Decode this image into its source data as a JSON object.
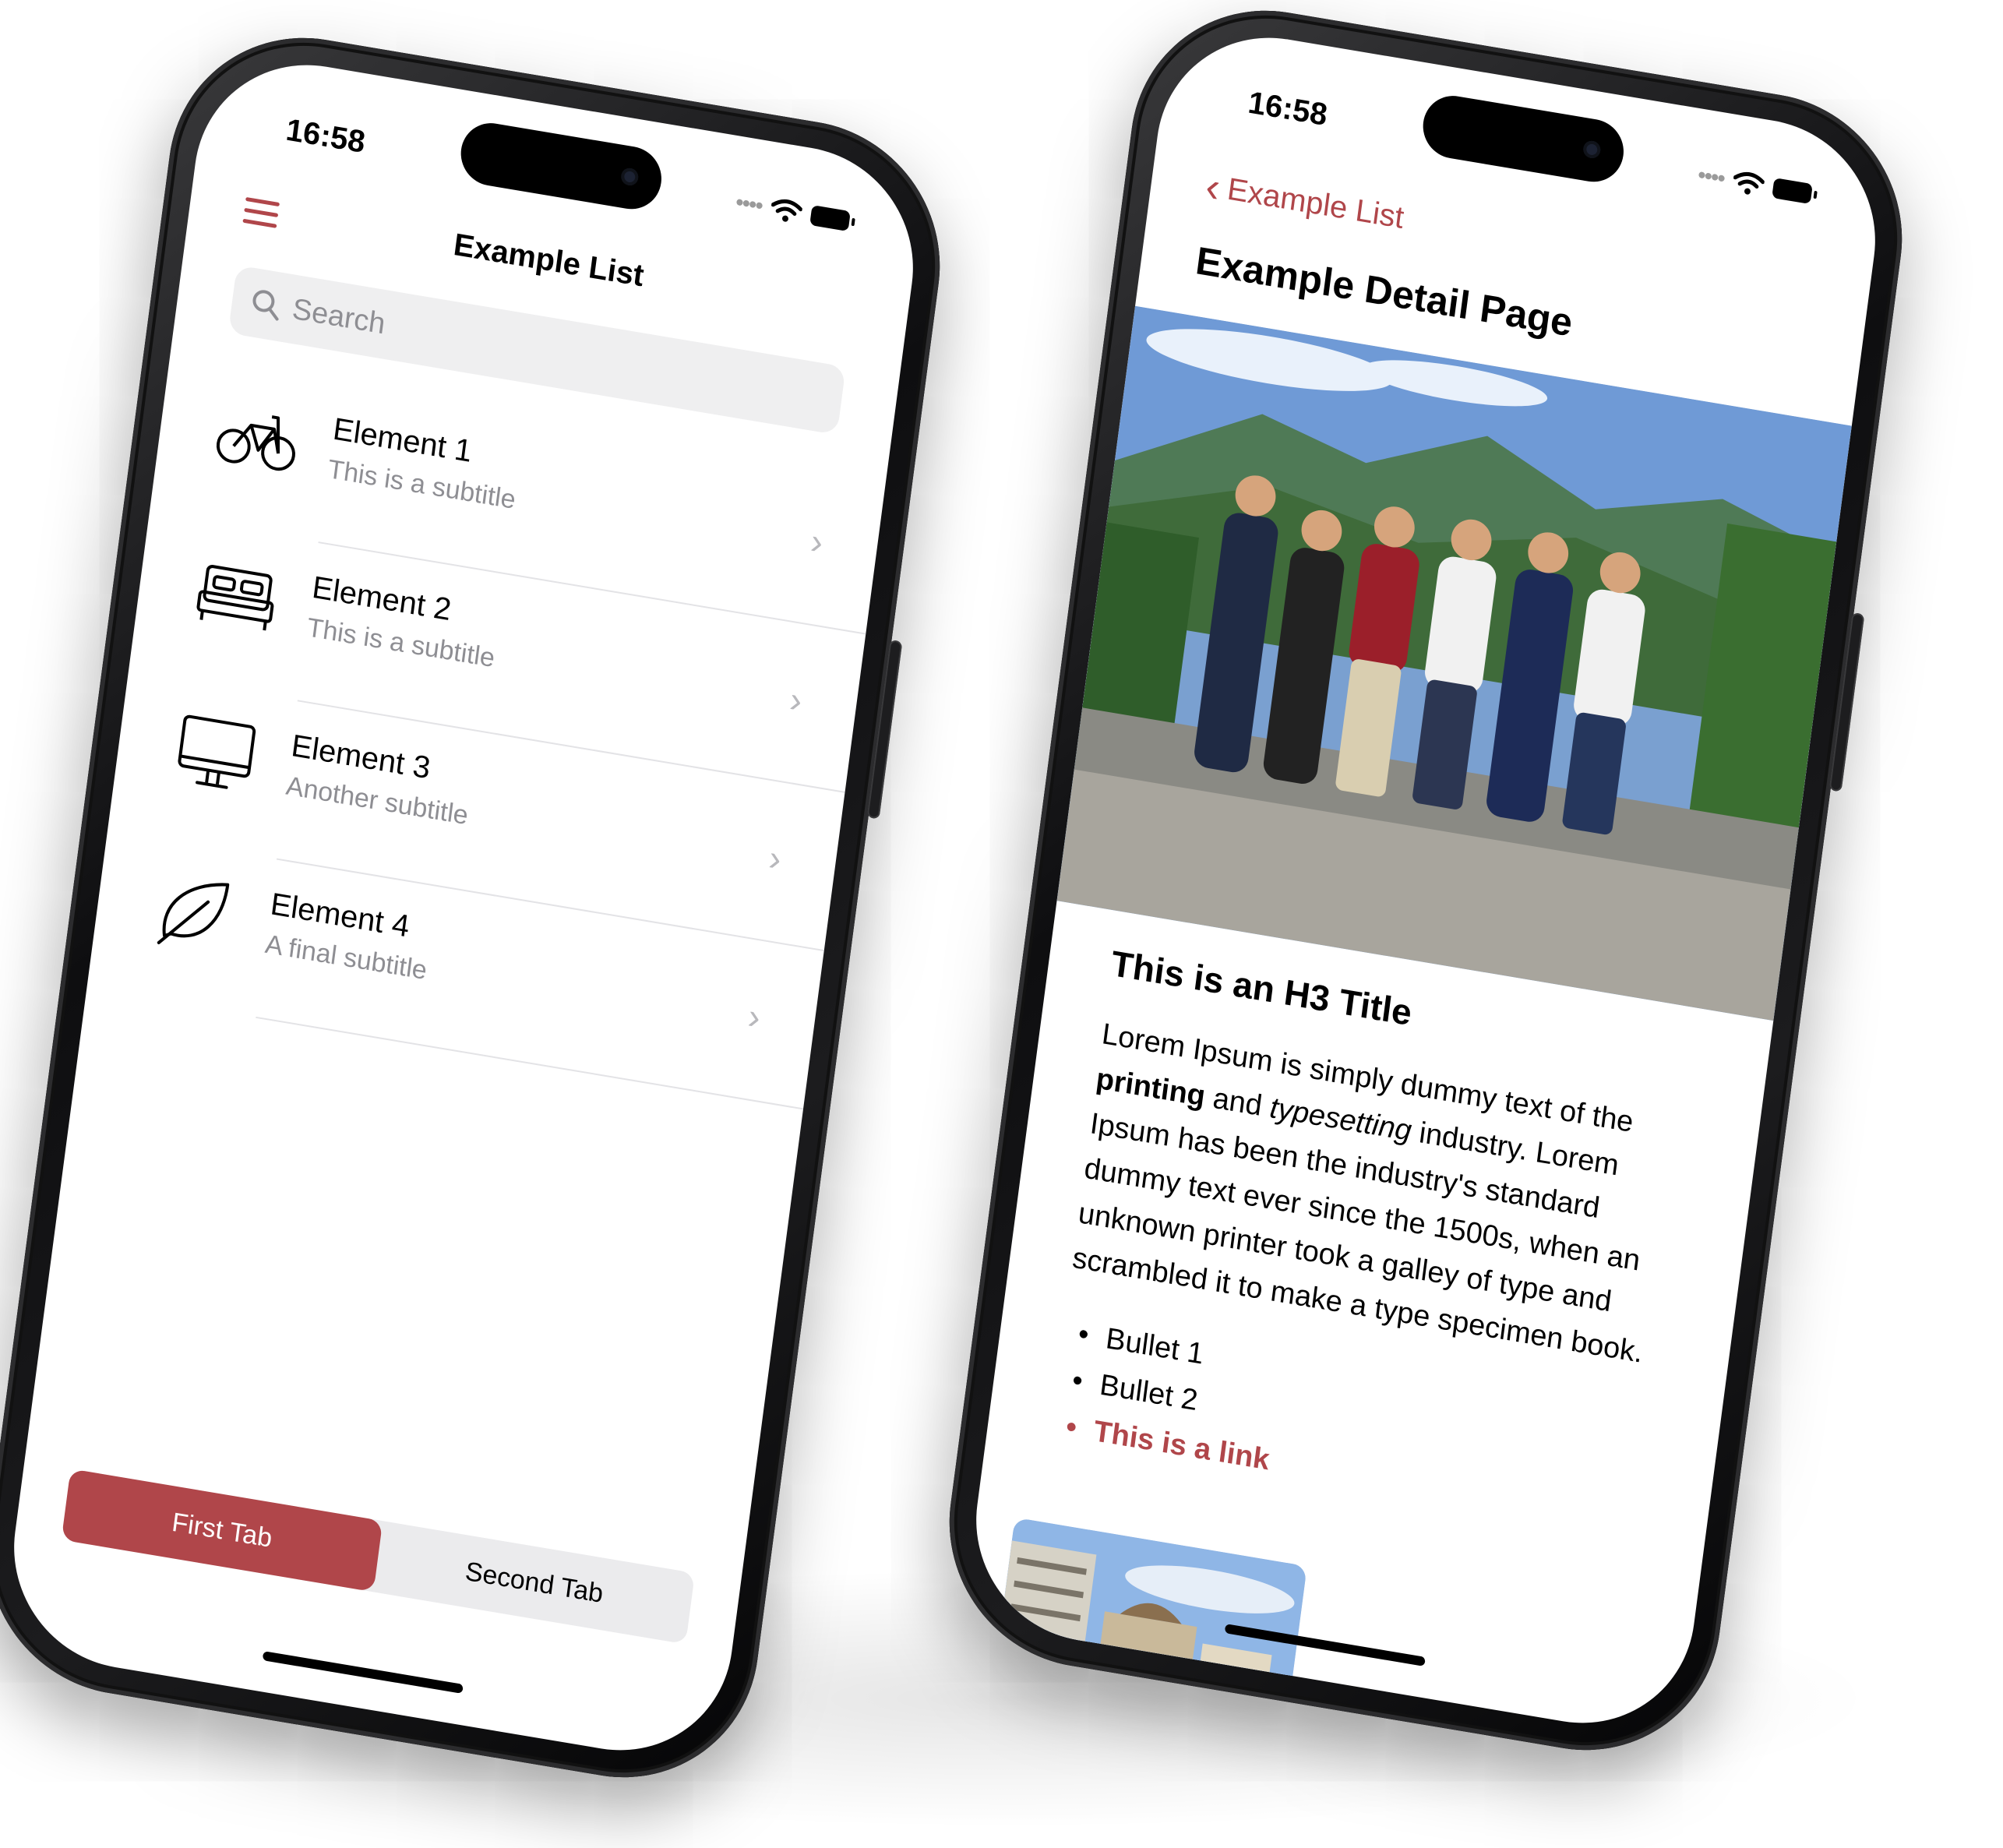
{
  "status": {
    "time": "16:58"
  },
  "list_screen": {
    "nav_title": "Example List",
    "search": {
      "placeholder": "Search"
    },
    "items": [
      {
        "icon": "bicycle-icon",
        "title": "Element 1",
        "subtitle": "This is a subtitle"
      },
      {
        "icon": "bed-icon",
        "title": "Element 2",
        "subtitle": "This is a subtitle"
      },
      {
        "icon": "monitor-icon",
        "title": "Element 3",
        "subtitle": "Another subtitle"
      },
      {
        "icon": "leaf-icon",
        "title": "Element 4",
        "subtitle": "A final subtitle"
      }
    ],
    "tabs": [
      {
        "label": "First Tab",
        "active": true
      },
      {
        "label": "Second Tab",
        "active": false
      }
    ]
  },
  "detail_screen": {
    "back_label": "Example List",
    "page_title": "Example Detail Page",
    "h3_title": "This is an H3 Title",
    "paragraph": {
      "part1": "Lorem Ipsum is simply dummy text of the ",
      "bold": "printing",
      "part2": " and ",
      "italic": "typesetting",
      "part3": " industry. Lorem Ipsum has been the industry's standard dummy text ever since the 1500s, when an unknown printer took a galley of type and scrambled it to make a type specimen book."
    },
    "bullets": [
      "Bullet 1",
      "Bullet 2"
    ],
    "link_label": "This is a link"
  },
  "colors": {
    "accent": "#b0464a",
    "separator": "#e3e3e6",
    "search_bg": "#efeff0",
    "subtitle": "#8e8e93"
  }
}
